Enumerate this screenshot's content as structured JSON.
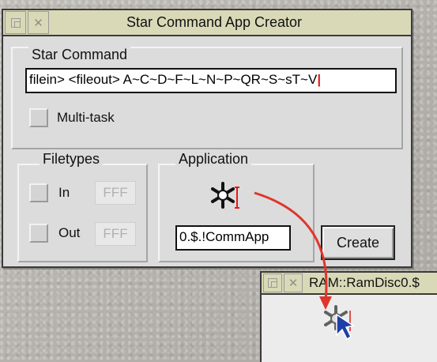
{
  "main_window": {
    "title": "Star Command App Creator",
    "star_command": {
      "label": "Star Command",
      "value": "filein> <fileout> A~C~D~F~L~N~P~QR~S~sT~V",
      "multitask_label": "Multi-task"
    },
    "filetypes": {
      "label": "Filetypes",
      "in_label": "In",
      "in_value": "FFF",
      "out_label": "Out",
      "out_value": "FFF"
    },
    "application": {
      "label": "Application",
      "path": "0.$.!CommApp",
      "icon": "asterisk-app-icon"
    },
    "create_label": "Create"
  },
  "ram_window": {
    "title": "RAM::RamDisc0.$",
    "icon": "dragged-app-icon"
  },
  "colors": {
    "titlebar": "#d9d9b8",
    "window": "#dcdcdc",
    "drag_arrow": "#e0352b",
    "pointer": "#1f3fa8"
  }
}
